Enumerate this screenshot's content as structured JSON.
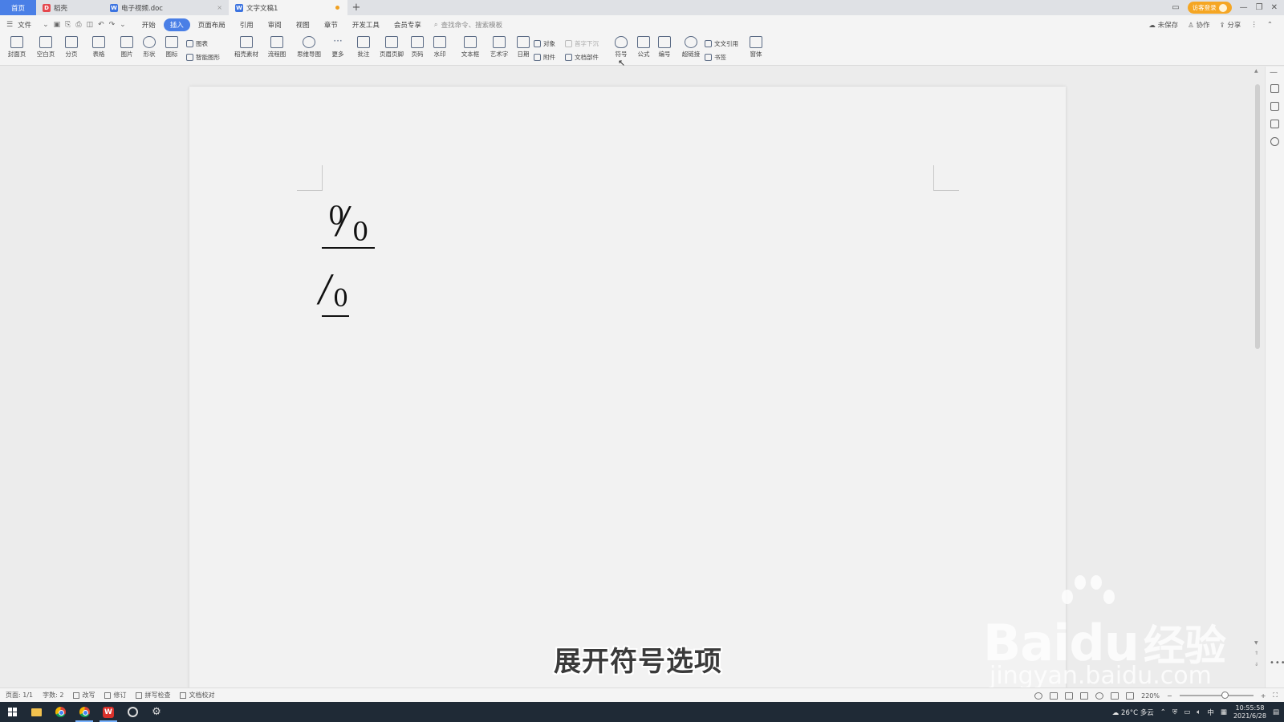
{
  "tabs": {
    "home": "首页",
    "t1": "稻壳",
    "t2": "电子视频.doc",
    "t3": "文字文稿1",
    "new_tab": "+"
  },
  "header_right": {
    "login": "访客登录"
  },
  "menubar": {
    "file": "文件",
    "items": [
      "开始",
      "插入",
      "页面布局",
      "引用",
      "审阅",
      "视图",
      "章节",
      "开发工具",
      "会员专享"
    ],
    "active_index": 1,
    "search": "查找命令、搜索模板",
    "unsaved": "未保存",
    "collab": "协作",
    "share": "分享"
  },
  "ribbon": {
    "buttons": [
      {
        "label": "封面页"
      },
      {
        "label": "空白页"
      },
      {
        "label": "分页"
      },
      {
        "label": "表格"
      },
      {
        "label": "图片"
      },
      {
        "label": "形状"
      },
      {
        "label": "图标"
      },
      {
        "label": "稻壳素材"
      },
      {
        "label": "流程图"
      },
      {
        "label": "思维导图"
      },
      {
        "label": "更多"
      },
      {
        "label": "批注"
      },
      {
        "label": "页眉页脚"
      },
      {
        "label": "页码"
      },
      {
        "label": "水印"
      },
      {
        "label": "文本框"
      },
      {
        "label": "艺术字"
      },
      {
        "label": "日期"
      },
      {
        "label": "符号"
      },
      {
        "label": "公式"
      },
      {
        "label": "编号"
      },
      {
        "label": "超链接"
      },
      {
        "label": "窗体"
      }
    ],
    "small": {
      "chart": "图表",
      "smart_shape": "智能图形",
      "object": "对象",
      "attachment": "附件",
      "drop_cap": "首字下沉",
      "doc_parts": "文档部件",
      "cross_ref": "文文引用",
      "bookmark": "书签"
    }
  },
  "document": {
    "symbol_large": {
      "top": "0",
      "slash": "⁄",
      "bottom": "0"
    },
    "symbol_small": {
      "slash": "⁄",
      "bottom": "0"
    }
  },
  "subtitle": "展开符号选项",
  "watermark": {
    "brand": "Bai",
    "brand_du": "du",
    "brand_cn": "经验",
    "url": "jingyan.baidu.com"
  },
  "statusbar": {
    "page": "页面: 1/1",
    "words": "字数: 2",
    "overwrite": "改写",
    "revision": "修订",
    "spell": "拼写检查",
    "proof": "文档校对",
    "zoom": "220%"
  },
  "taskbar": {
    "weather": "26°C 多云",
    "ime": "中",
    "time": "10:55:58",
    "date": "2021/6/28"
  }
}
